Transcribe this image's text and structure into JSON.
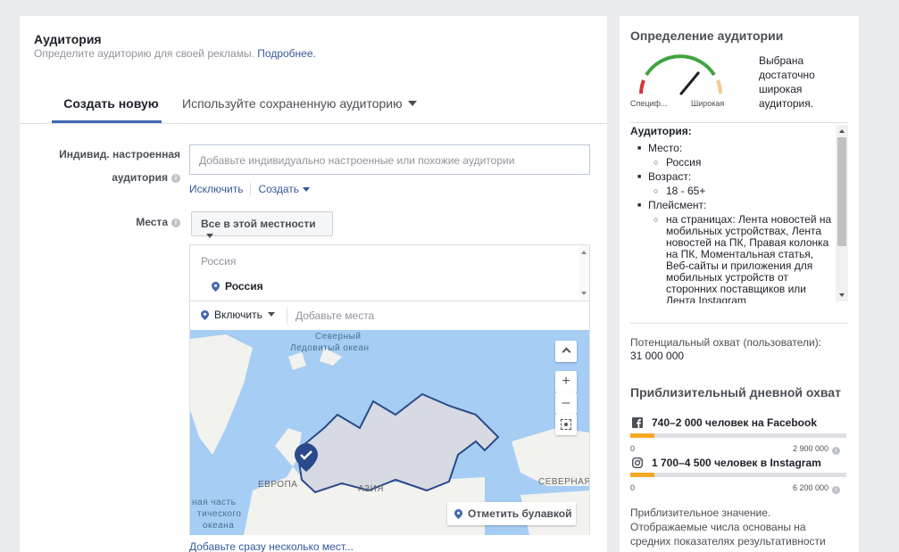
{
  "audience": {
    "title": "Аудитория",
    "subtitle": "Определите аудиторию для своей рекламы.",
    "learn_more": "Подробнее."
  },
  "tabs": {
    "create_new": "Создать новую",
    "use_saved": "Используйте сохраненную аудиторию"
  },
  "custom_audience": {
    "label_line1": "Индивид. настроенная",
    "label_line2": "аудитория",
    "placeholder": "Добавьте индивидуально настроенные или похожие аудитории",
    "exclude": "Исключить",
    "create": "Создать"
  },
  "places": {
    "label": "Места",
    "selector": "Все в этой местности",
    "country_header": "Россия",
    "selected_location": "Россия",
    "include": "Включить",
    "add_places_placeholder": "Добавьте места",
    "map_labels": {
      "ocean_1": "Северный",
      "ocean_2": "Ледовитый океан",
      "europe": "ЕВРОПА",
      "asia": "АЗИЯ",
      "north": "СЕВЕРНАЯ",
      "atlantic_1": "ная часть",
      "atlantic_2": "тического",
      "atlantic_3": "океана"
    },
    "drop_pin": "Отметить булавкой",
    "add_several": "Добавьте сразу несколько мест..."
  },
  "definition": {
    "title": "Определение аудитории",
    "gauge_specific": "Специф...",
    "gauge_broad": "Широкая",
    "gauge_level": 0.72,
    "gauge_text": "Выбрана достаточно широкая аудитория.",
    "audience_header": "Аудитория:",
    "place_label": "Место:",
    "place_value": "Россия",
    "age_label": "Возраст:",
    "age_value": "18 - 65+",
    "placement_label": "Плейсмент:",
    "placement_value": "на страницах: Лента новостей на мобильных устройствах, Лента новостей на ПК, Правая колонка на ПК, Моментальная статья, Веб-сайты и приложения для мобильных устройств от сторонних поставщиков или Лента Instagram",
    "potential_reach_label": "Потенциальный охват (пользователи):",
    "potential_reach_value": "31 000 000",
    "daily_reach_title": "Приблизительный дневной охват",
    "facebook": {
      "text": "740–2 000 человек на Facebook",
      "min": "0",
      "max": "2 900 000",
      "fill": 0.11
    },
    "instagram": {
      "text": "1 700–4 500 человек в Instagram",
      "min": "0",
      "max": "6 200 000",
      "fill": 0.11
    },
    "note": "Приблизительное значение. Отображаемые числа основаны на средних показателях результативности"
  },
  "colors": {
    "accent": "#4267b2",
    "link": "#365899",
    "bar_fill": "#f7a823",
    "map_water": "#a6cdf3",
    "map_land": "#f2f2ef",
    "map_selected": "#d7dae2"
  }
}
